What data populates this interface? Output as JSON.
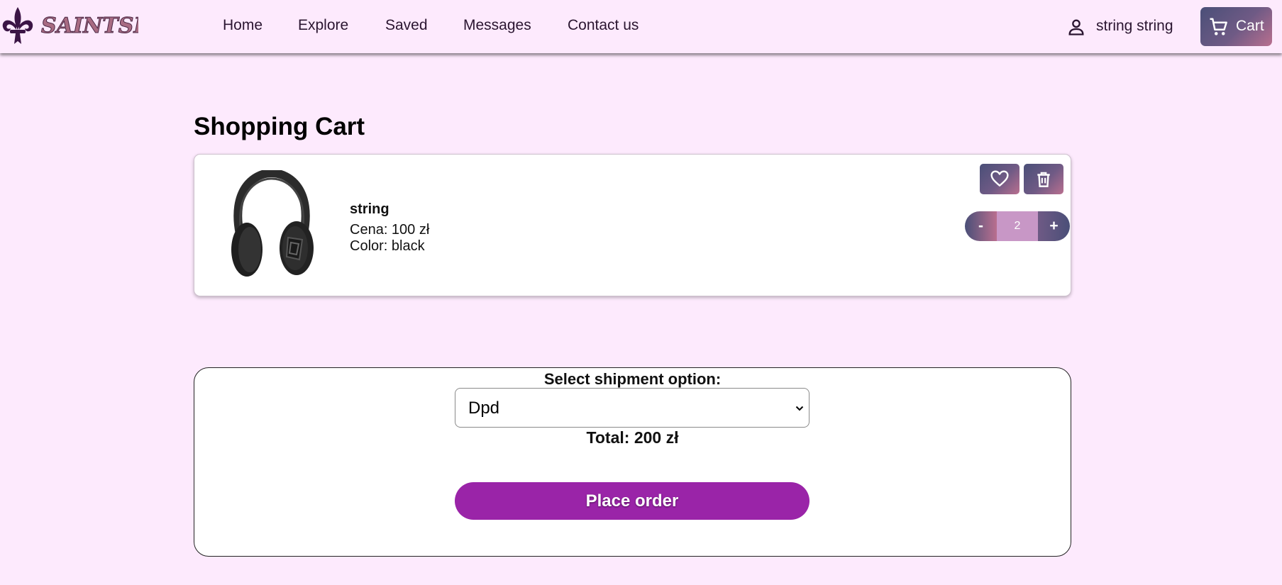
{
  "brand": {
    "logo_text": "SAINTSROW"
  },
  "nav": {
    "items": [
      {
        "label": "Home"
      },
      {
        "label": "Explore"
      },
      {
        "label": "Saved"
      },
      {
        "label": "Messages"
      },
      {
        "label": "Contact us"
      }
    ]
  },
  "user": {
    "name": "string string",
    "icon": "person-icon"
  },
  "cart_button": {
    "label": "Cart",
    "icon": "cart-icon"
  },
  "page": {
    "title": "Shopping Cart"
  },
  "cart_items": [
    {
      "name": "string",
      "price": "Cena: 100 zł",
      "color": "Color: black",
      "image": "headphones",
      "quantity": "2",
      "minus_label": "-",
      "plus_label": "+",
      "favorite_icon": "heart-icon",
      "delete_icon": "trash-icon"
    }
  ],
  "checkout": {
    "shipment_label": "Select shipment option:",
    "shipment_selected": "Dpd",
    "total": "Total: 200 zł",
    "place_order_label": "Place order"
  },
  "colors": {
    "page_background": "#fdeafd",
    "accent_gradient_start": "#4a4f78",
    "accent_gradient_end": "#b96f8f",
    "order_button": "#9a24a8",
    "quantity_field": "#c897c6"
  }
}
